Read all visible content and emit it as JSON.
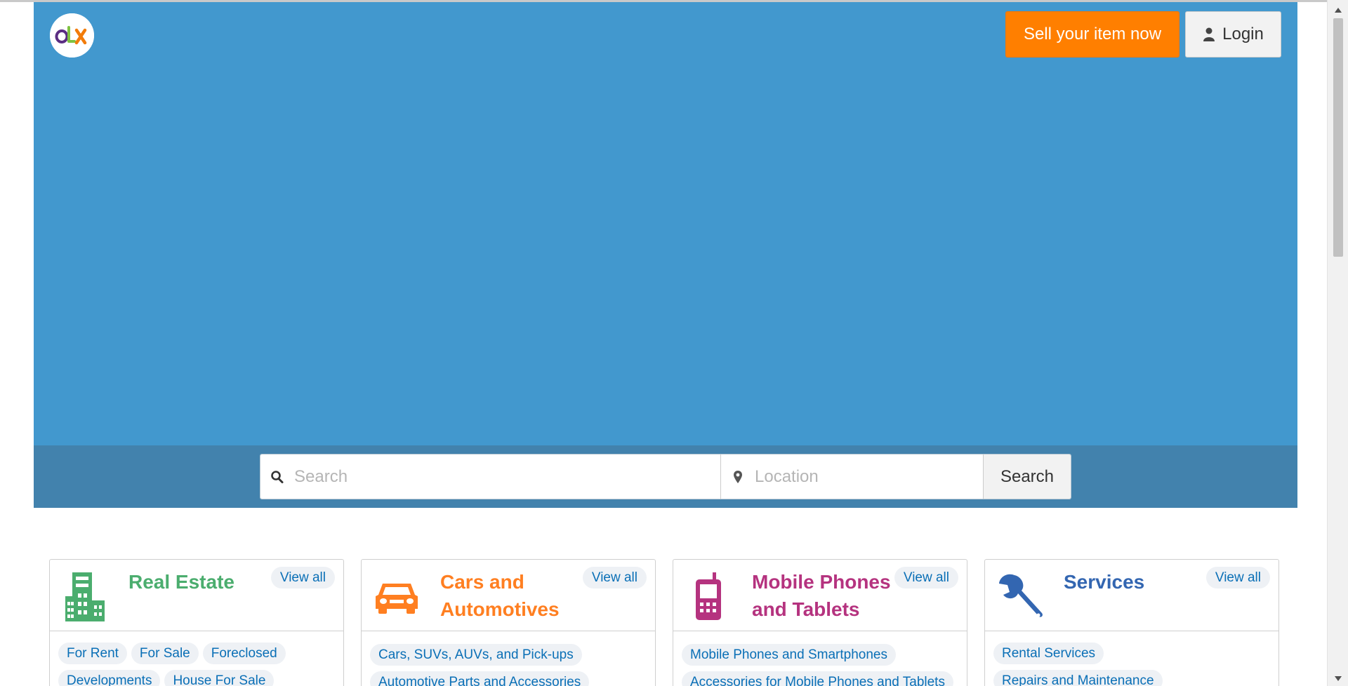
{
  "header": {
    "logo_text": "OLX",
    "sell_label": "Sell your item now",
    "login_label": "Login"
  },
  "search": {
    "query_placeholder": "Search",
    "query_value": "",
    "location_placeholder": "Location",
    "location_value": "",
    "button_label": "Search"
  },
  "categories": [
    {
      "title": "Real Estate",
      "color": "#4bad6e",
      "icon": "building-icon",
      "view_all": "View all",
      "tags": [
        "For Rent",
        "For Sale",
        "Foreclosed",
        "Developments",
        "House For Sale"
      ]
    },
    {
      "title": "Cars and Automotives",
      "color": "#ff7f21",
      "icon": "car-icon",
      "view_all": "View all",
      "tags": [
        "Cars, SUVs, AUVs, and Pick-ups",
        "Automotive Parts and Accessories"
      ]
    },
    {
      "title": "Mobile Phones and Tablets",
      "color": "#b5337f",
      "icon": "mobile-phone-icon",
      "view_all": "View all",
      "tags": [
        "Mobile Phones and Smartphones",
        "Accessories for Mobile Phones and Tablets"
      ]
    },
    {
      "title": "Services",
      "color": "#3366b1",
      "icon": "wrench-icon",
      "view_all": "View all",
      "tags": [
        "Rental Services",
        "Repairs and Maintenance"
      ]
    }
  ],
  "colors": {
    "hero": "#4298ce",
    "searchbar": "#4282ad",
    "sell_button": "#ff7f00",
    "link": "#0a6fb6"
  }
}
